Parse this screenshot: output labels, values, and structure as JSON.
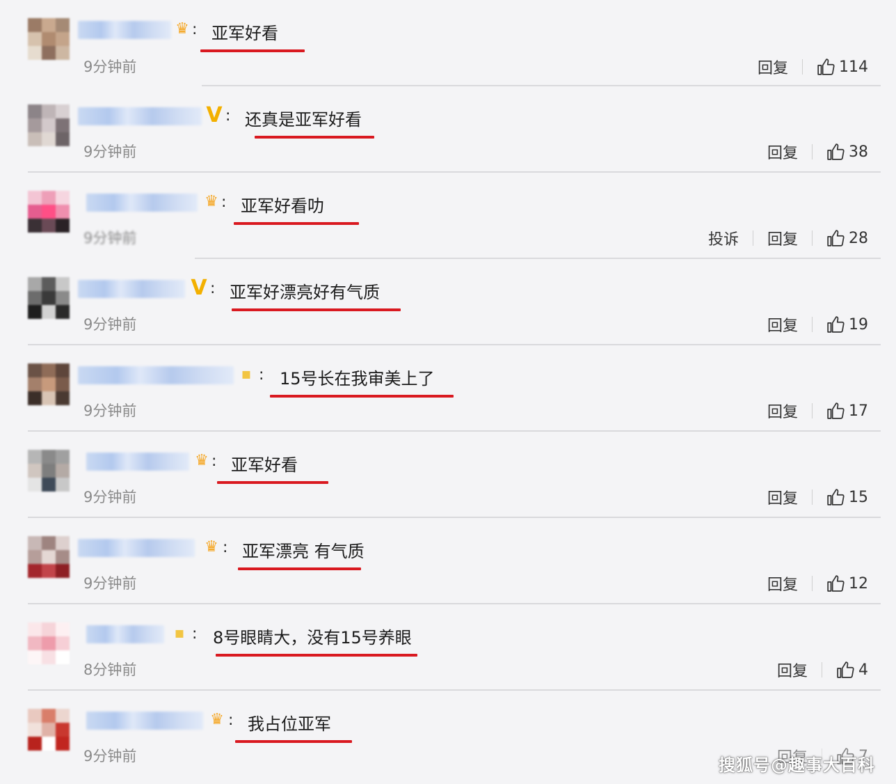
{
  "comments": [
    {
      "text": "亚军好看",
      "time": "9分钟前",
      "reply": "回复",
      "report": "",
      "likes": "114",
      "badge": "crown-badge-icon"
    },
    {
      "text": "还真是亚军好看",
      "time": "9分钟前",
      "reply": "回复",
      "report": "",
      "likes": "38",
      "badge": "v-badge-icon"
    },
    {
      "text": "亚军好看叻",
      "time": "9分钟前",
      "reply": "回复",
      "report": "投诉",
      "likes": "28",
      "badge": "crown-badge-icon"
    },
    {
      "text": "亚军好漂亮好有气质",
      "time": "9分钟前",
      "reply": "回复",
      "report": "",
      "likes": "19",
      "badge": "v-badge-icon"
    },
    {
      "text": "15号长在我审美上了",
      "time": "9分钟前",
      "reply": "回复",
      "report": "",
      "likes": "17",
      "badge": "star-badge-icon"
    },
    {
      "text": "亚军好看",
      "time": "9分钟前",
      "reply": "回复",
      "report": "",
      "likes": "15",
      "badge": "crown-badge-icon"
    },
    {
      "text": "亚军漂亮 有气质",
      "time": "9分钟前",
      "reply": "回复",
      "report": "",
      "likes": "12",
      "badge": "crown-badge-icon"
    },
    {
      "text": "8号眼睛大，没有15号养眼",
      "time": "8分钟前",
      "reply": "回复",
      "report": "",
      "likes": "4",
      "badge": "star-badge-icon"
    },
    {
      "text": "我占位亚军",
      "time": "9分钟前",
      "reply": "回复",
      "report": "",
      "likes": "7",
      "badge": "crown-badge-icon"
    }
  ],
  "watermark": "搜狐号@趣事大百科",
  "colors": {
    "underline": "#d91920",
    "background": "#f4f4f6",
    "divider": "#d9d9dc"
  }
}
